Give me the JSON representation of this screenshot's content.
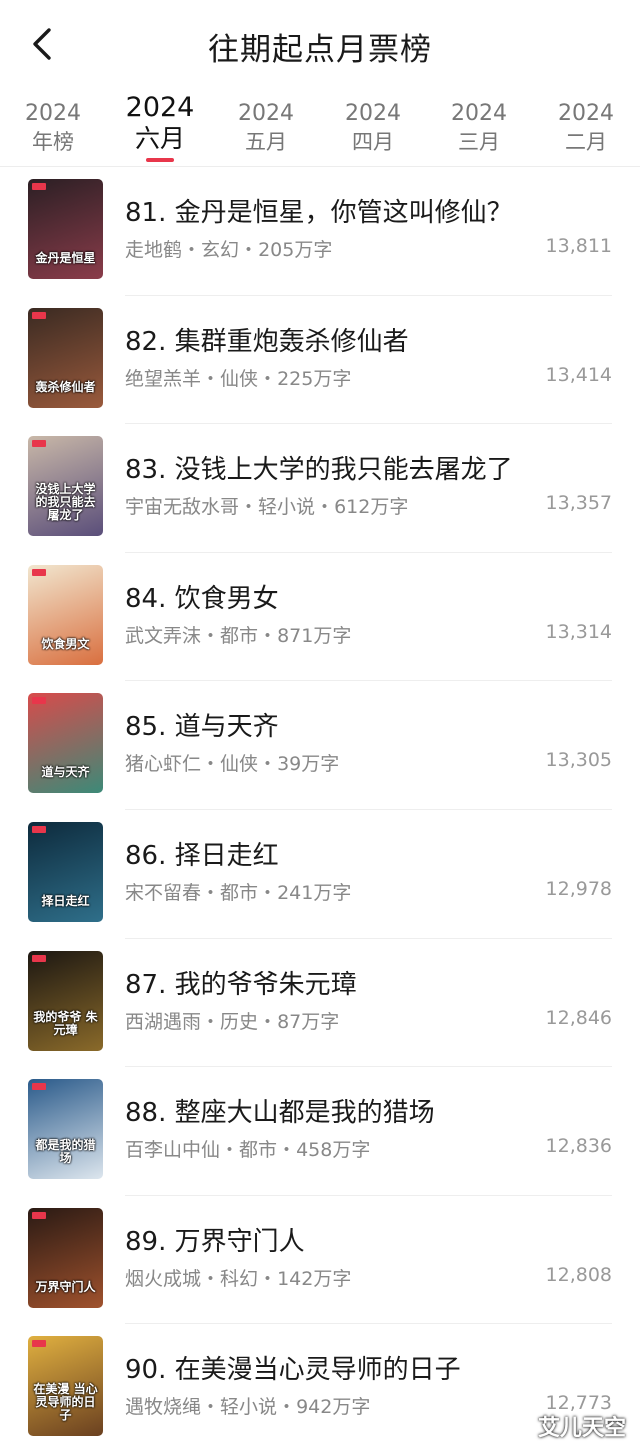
{
  "header": {
    "title": "往期起点月票榜"
  },
  "tabs": [
    {
      "year": "2024",
      "month": "年榜"
    },
    {
      "year": "2024",
      "month": "六月"
    },
    {
      "year": "2024",
      "month": "五月"
    },
    {
      "year": "2024",
      "month": "四月"
    },
    {
      "year": "2024",
      "month": "三月"
    },
    {
      "year": "2024",
      "month": "二月"
    }
  ],
  "active_tab": "六月",
  "colors": {
    "accent": "#e8364b"
  },
  "books": [
    {
      "title": "81. 金丹是恒星，你管这叫修仙？",
      "author": "走地鹤",
      "genre": "玄幻",
      "words": "205万字",
      "votes": "13,811",
      "cover_text": "金丹是恒星",
      "cover_colors": [
        "#2b1f24",
        "#8a3c4a"
      ]
    },
    {
      "title": "82. 集群重炮轰杀修仙者",
      "author": "绝望羔羊",
      "genre": "仙侠",
      "words": "225万字",
      "votes": "13,414",
      "cover_text": "轰杀修仙者",
      "cover_colors": [
        "#3a2a22",
        "#9a5a3c"
      ]
    },
    {
      "title": "83. 没钱上大学的我只能去屠龙了",
      "author": "宇宙无敌水哥",
      "genre": "轻小说",
      "words": "612万字",
      "votes": "13,357",
      "cover_text": "没钱上大学的我只能去屠龙了",
      "cover_colors": [
        "#c9b8a8",
        "#5a4e7a"
      ]
    },
    {
      "title": "84. 饮食男女",
      "author": "武文弄沫",
      "genre": "都市",
      "words": "871万字",
      "votes": "13,314",
      "cover_text": "饮食男文",
      "cover_colors": [
        "#f1e6cf",
        "#d96f3f"
      ]
    },
    {
      "title": "85. 道与天齐",
      "author": "猪心虾仁",
      "genre": "仙侠",
      "words": "39万字",
      "votes": "13,305",
      "cover_text": "道与天齐",
      "cover_colors": [
        "#d84b4b",
        "#3c8a78"
      ]
    },
    {
      "title": "86. 择日走红",
      "author": "宋不留春",
      "genre": "都市",
      "words": "241万字",
      "votes": "12,978",
      "cover_text": "择日走红",
      "cover_colors": [
        "#0d2a3c",
        "#2f6f8a"
      ]
    },
    {
      "title": "87. 我的爷爷朱元璋",
      "author": "西湖遇雨",
      "genre": "历史",
      "words": "87万字",
      "votes": "12,846",
      "cover_text": "我的爷爷 朱元璋",
      "cover_colors": [
        "#1c1712",
        "#8a6a2a"
      ]
    },
    {
      "title": "88. 整座大山都是我的猎场",
      "author": "百李山中仙",
      "genre": "都市",
      "words": "458万字",
      "votes": "12,836",
      "cover_text": "都是我的猎场",
      "cover_colors": [
        "#2a5a8a",
        "#dde6ee"
      ]
    },
    {
      "title": "89. 万界守门人",
      "author": "烟火成城",
      "genre": "科幻",
      "words": "142万字",
      "votes": "12,808",
      "cover_text": "万界守门人",
      "cover_colors": [
        "#2a1a14",
        "#a0522d"
      ]
    },
    {
      "title": "90. 在美漫当心灵导师的日子",
      "author": "遇牧烧绳",
      "genre": "轻小说",
      "words": "942万字",
      "votes": "12,773",
      "cover_text": "在美漫 当心灵导师的日子",
      "cover_colors": [
        "#e0b040",
        "#6a4020"
      ]
    }
  ],
  "separator": "・",
  "watermark": "艾儿天空"
}
